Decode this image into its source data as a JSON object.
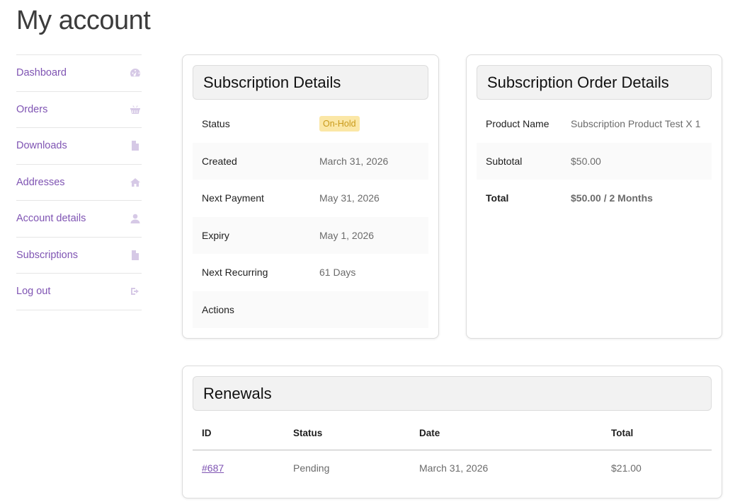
{
  "page": {
    "title": "My account"
  },
  "nav": {
    "items": [
      {
        "label": "Dashboard",
        "icon": "dashboard-icon"
      },
      {
        "label": "Orders",
        "icon": "basket-icon"
      },
      {
        "label": "Downloads",
        "icon": "file-download-icon"
      },
      {
        "label": "Addresses",
        "icon": "home-icon"
      },
      {
        "label": "Account details",
        "icon": "user-icon"
      },
      {
        "label": "Subscriptions",
        "icon": "document-icon"
      },
      {
        "label": "Log out",
        "icon": "sign-out-icon"
      }
    ]
  },
  "subscription": {
    "heading": "Subscription Details",
    "rows": [
      {
        "label": "Status",
        "value": "On-Hold"
      },
      {
        "label": "Created",
        "value": "March 31, 2026"
      },
      {
        "label": "Next Payment",
        "value": "May 31, 2026"
      },
      {
        "label": "Expiry",
        "value": "May 1, 2026"
      },
      {
        "label": "Next Recurring",
        "value": "61 Days"
      },
      {
        "label": "Actions",
        "value": ""
      }
    ]
  },
  "order": {
    "heading": "Subscription Order Details",
    "rows": [
      {
        "label": "Product Name",
        "value": "Subscription Product Test X 1"
      },
      {
        "label": "Subtotal",
        "value": "$50.00"
      },
      {
        "label": "Total",
        "value": "$50.00 / 2 Months"
      }
    ]
  },
  "renewals": {
    "heading": "Renewals",
    "columns": [
      "ID",
      "Status",
      "Date",
      "Total"
    ],
    "rows": [
      {
        "id": "#687",
        "status": "Pending",
        "date": "March 31, 2026",
        "total": "$21.00"
      }
    ]
  },
  "colors": {
    "accent": "#7f54b3",
    "icon": "#d6c9e6",
    "badge_bg": "#fbe7a6",
    "badge_text": "#c99a1a"
  }
}
